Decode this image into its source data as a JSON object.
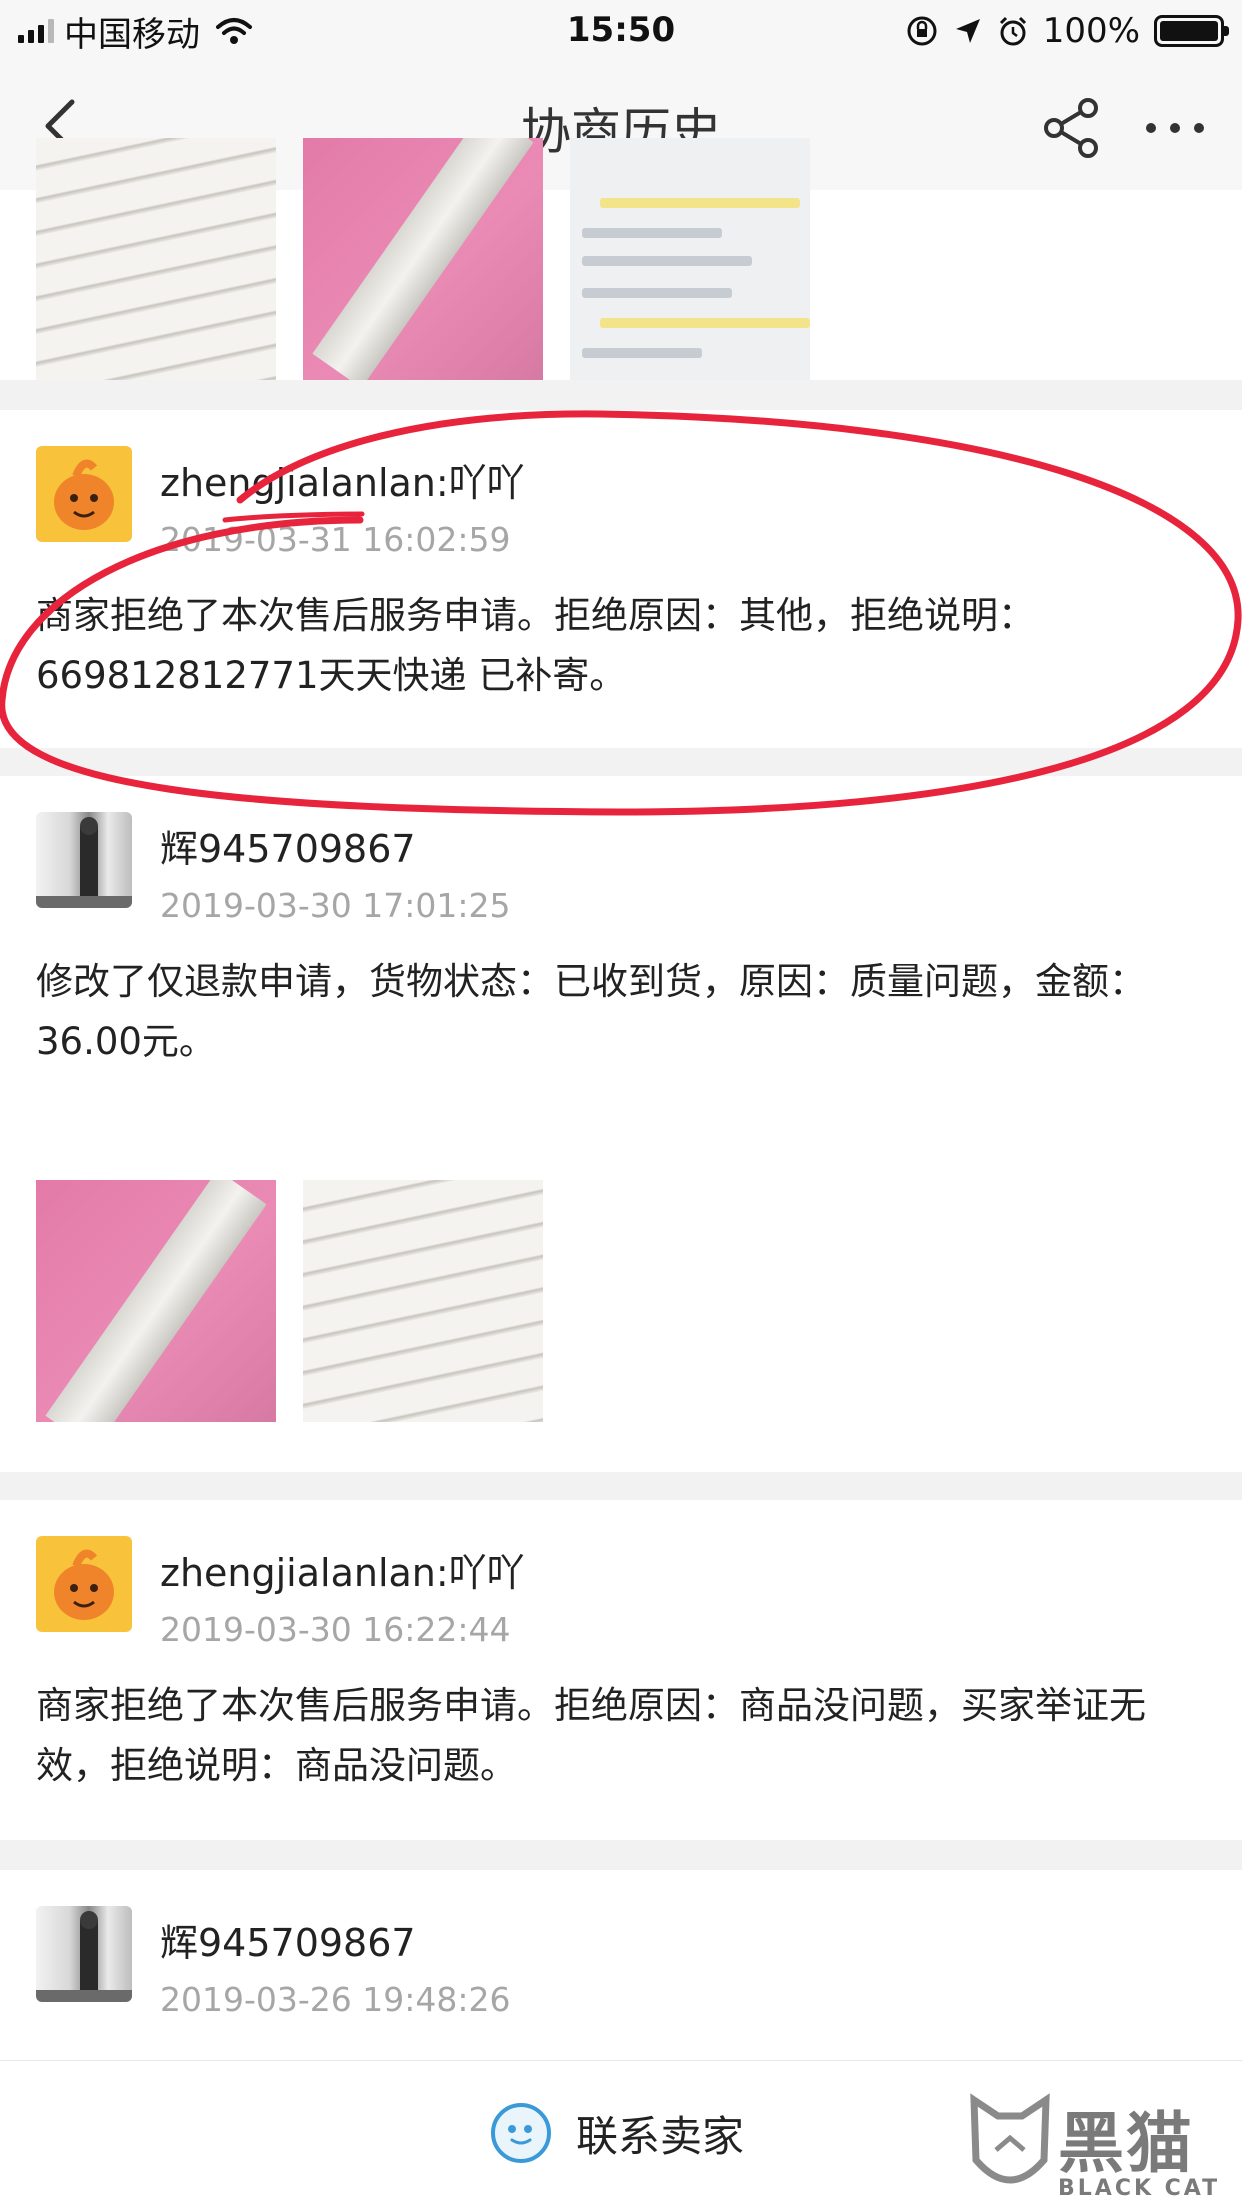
{
  "status_bar": {
    "carrier": "中国移动",
    "time": "15:50",
    "battery": "100%"
  },
  "nav": {
    "title": "协商历史",
    "back_icon": "chevron-left-icon",
    "share_icon": "share-icon",
    "more_icon": "more-icon"
  },
  "entries": [
    {
      "user": "zhengjialanlan:吖吖",
      "time": "2019-03-31 16:02:59",
      "message": "商家拒绝了本次售后服务申请。拒绝原因：其他，拒绝说明：669812812771天天快递 已补寄。"
    },
    {
      "user": "辉945709867",
      "time": "2019-03-30 17:01:25",
      "message": "修改了仅退款申请，货物状态：已收到货，原因：质量问题，金额：36.00元。"
    },
    {
      "user": "zhengjialanlan:吖吖",
      "time": "2019-03-30 16:22:44",
      "message": "商家拒绝了本次售后服务申请。拒绝原因：商品没问题，买家举证无效，拒绝说明：商品没问题。"
    },
    {
      "user": "辉945709867",
      "time": "2019-03-26 19:48:26"
    }
  ],
  "bottom": {
    "contact_label": "联系卖家",
    "contact_icon": "chat-bubble-icon"
  },
  "watermark": {
    "text": "黑猫",
    "sub": "BLACK CAT"
  },
  "colors": {
    "annotation": "#e8243c",
    "timestamp": "#a6a6a6",
    "avatar_orange": "#f8c23a"
  }
}
